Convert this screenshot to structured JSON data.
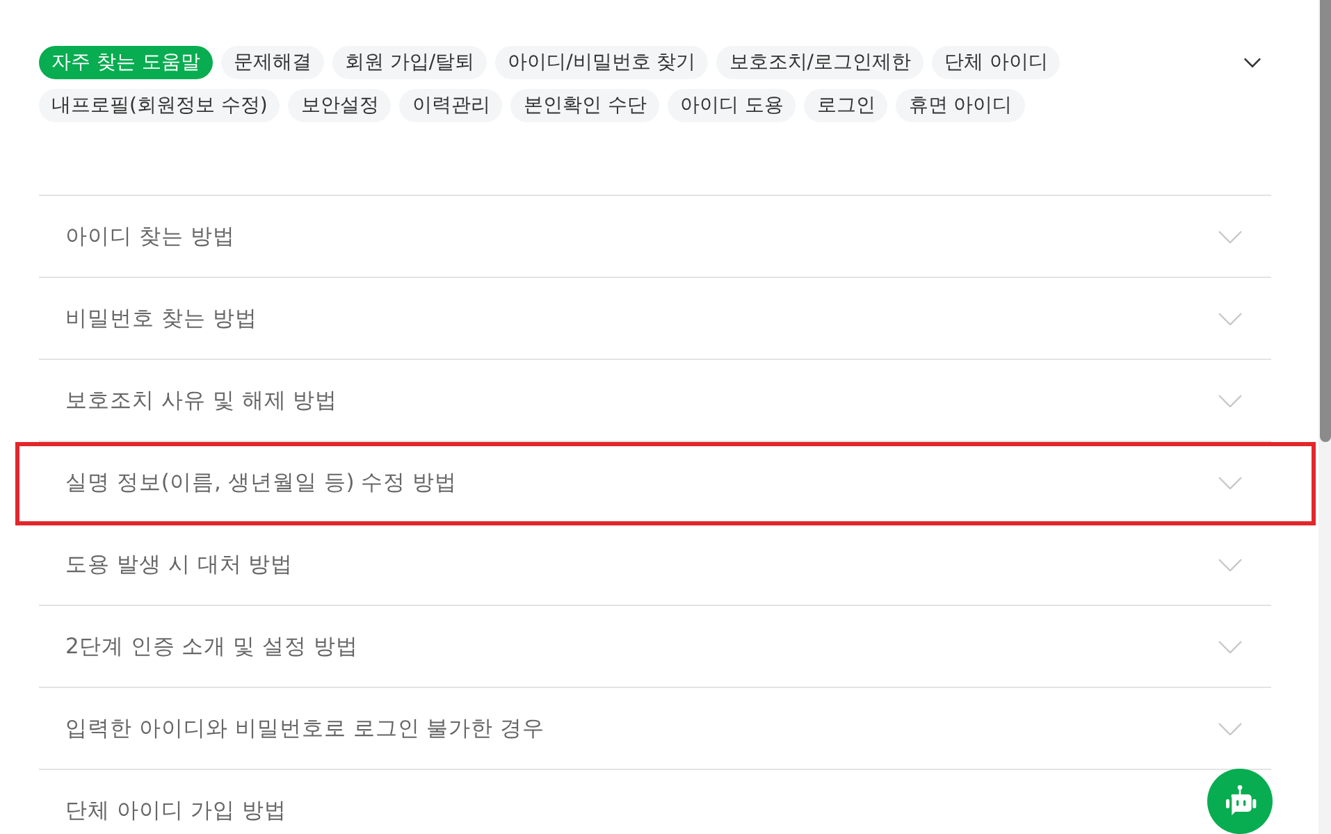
{
  "categories": [
    {
      "label": "자주 찾는 도움말",
      "selected": true
    },
    {
      "label": "문제해결",
      "selected": false
    },
    {
      "label": "회원 가입/탈퇴",
      "selected": false
    },
    {
      "label": "아이디/비밀번호 찾기",
      "selected": false
    },
    {
      "label": "보호조치/로그인제한",
      "selected": false
    },
    {
      "label": "단체 아이디",
      "selected": false
    },
    {
      "label": "내프로필(회원정보 수정)",
      "selected": false
    },
    {
      "label": "보안설정",
      "selected": false
    },
    {
      "label": "이력관리",
      "selected": false
    },
    {
      "label": "본인확인 수단",
      "selected": false
    },
    {
      "label": "아이디 도용",
      "selected": false
    },
    {
      "label": "로그인",
      "selected": false
    },
    {
      "label": "휴면 아이디",
      "selected": false
    }
  ],
  "category_toggle": {
    "expanded": false
  },
  "faq_items": [
    {
      "title": "아이디 찾는 방법",
      "expanded": false,
      "highlighted": false
    },
    {
      "title": "비밀번호 찾는 방법",
      "expanded": false,
      "highlighted": false
    },
    {
      "title": "보호조치 사유 및 해제 방법",
      "expanded": false,
      "highlighted": false
    },
    {
      "title": "실명 정보(이름, 생년월일 등) 수정 방법",
      "expanded": false,
      "highlighted": true
    },
    {
      "title": "도용 발생 시 대처 방법",
      "expanded": false,
      "highlighted": false
    },
    {
      "title": "2단계 인증 소개 및 설정 방법",
      "expanded": false,
      "highlighted": false
    },
    {
      "title": "입력한 아이디와 비밀번호로 로그인 불가한 경우",
      "expanded": false,
      "highlighted": false
    },
    {
      "title": "단체 아이디 가입 방법",
      "expanded": false,
      "highlighted": false
    }
  ]
}
